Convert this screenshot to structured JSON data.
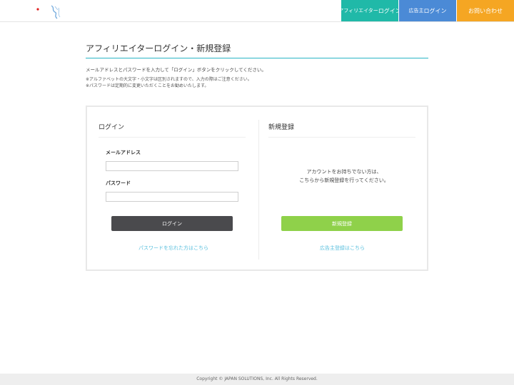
{
  "header": {
    "nav": {
      "affiliate_login_prefix": "アフィリエイター",
      "affiliate_login_suffix": "ログイン",
      "advertiser_login_prefix": "広告主",
      "advertiser_login_suffix": "ログイン",
      "contact": "お問い合わせ"
    }
  },
  "main": {
    "title": "アフィリエイターログイン・新規登録",
    "intro": "メールアドレスとパスワードを入力して「ログイン」ボタンをクリックしてください。",
    "notes": [
      "※アルファベットの大文字・小文字は区別されますので、入力の際はご注意ください。",
      "※パスワードは定期的に変更いただくことをお勧めいたします。"
    ]
  },
  "login": {
    "heading": "ログイン",
    "email_label": "メールアドレス",
    "email_value": "",
    "password_label": "パスワード",
    "password_value": "",
    "button": "ログイン",
    "forgot_link": "パスワードを忘れた方はこちら"
  },
  "register": {
    "heading": "新規登録",
    "text_line1": "アカウントをお持ちでない方は、",
    "text_line2": "こちらから新規登録を行ってください。",
    "button": "新規登録",
    "advertiser_link": "広告主登録はこちら"
  },
  "footer": {
    "copyright": "Copyright © JAPAN SOLUTIONS, Inc. All Rights Reserved."
  },
  "colors": {
    "affiliate_nav": "#20b9a8",
    "advertiser_nav": "#4b8ad6",
    "contact_nav": "#f5a623",
    "title_rule": "#2ab6c5",
    "login_button": "#4a4a4d",
    "register_button": "#8fd14a",
    "link": "#5bc0de"
  }
}
